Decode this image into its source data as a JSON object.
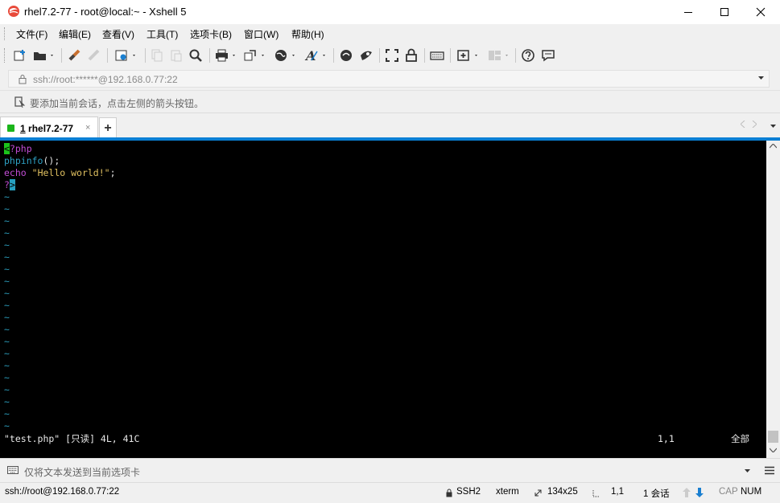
{
  "window": {
    "title": "rhel7.2-77 - root@local:~ - Xshell 5",
    "icon": "xshell-app-icon",
    "controls": [
      "minimize",
      "maximize",
      "close"
    ]
  },
  "menu": {
    "items": [
      {
        "label": "文件(F)"
      },
      {
        "label": "编辑(E)"
      },
      {
        "label": "查看(V)"
      },
      {
        "label": "工具(T)"
      },
      {
        "label": "选项卡(B)"
      },
      {
        "label": "窗口(W)"
      },
      {
        "label": "帮助(H)"
      }
    ]
  },
  "toolbar": {
    "icons": [
      "new-session-icon",
      "open-folder-icon",
      "reconnect-icon",
      "disconnect-icon",
      "properties-icon",
      "copy-icon",
      "paste-icon",
      "find-icon",
      "print-icon",
      "transfer-icon",
      "globe-icon",
      "font-icon",
      "xftp-icon",
      "xmanager-icon",
      "fullscreen-icon",
      "lock-icon",
      "keyboard-icon",
      "new-tab-icon",
      "layout-icon",
      "help-icon",
      "chat-icon"
    ]
  },
  "address": {
    "value": "ssh://root:******@192.168.0.77:22"
  },
  "hint": {
    "text": "要添加当前会话，点击左侧的箭头按钮。"
  },
  "tabs": {
    "active": {
      "number": "1",
      "label": "rhel7.2-77",
      "close": "×"
    },
    "new_tab": "+"
  },
  "terminal": {
    "lines": [
      {
        "cursor": "<",
        "rest": "?php"
      },
      {
        "func": "phpinfo",
        "punct": "();"
      },
      {
        "kw": "echo",
        "str": "\"Hello world!\"",
        "punct": ";"
      },
      {
        "pre": "?",
        "cursor": ">"
      }
    ],
    "tilde": "~",
    "status_left": "\"test.php\" [只读] 4L, 41C",
    "status_pos": "1,1",
    "status_right": "全部"
  },
  "input_bar": {
    "placeholder": "仅将文本发送到当前选项卡"
  },
  "statusbar": {
    "connection": "ssh://root@192.168.0.77:22",
    "protocol": "SSH2",
    "term_type": "xterm",
    "size": "134x25",
    "cursor": "1,1",
    "sessions": "1 会话",
    "cap": "CAP",
    "num": "NUM"
  },
  "colors": {
    "accent": "#0a7fd4",
    "terminal_bg": "#000000",
    "php_tag": "#c24dd6",
    "function": "#2ea2c6",
    "string": "#e0c060",
    "tilde": "#2a9ab8",
    "cursor": "#1bc41b"
  }
}
